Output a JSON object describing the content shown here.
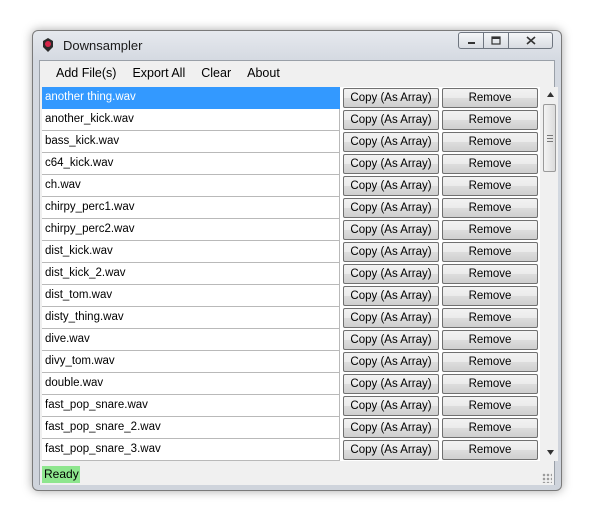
{
  "window": {
    "title": "Downsampler",
    "icons": {
      "app": "app-icon",
      "minimize": "minimize-icon",
      "maximize": "maximize-icon",
      "close": "close-icon"
    }
  },
  "menu": {
    "add_files": "Add File(s)",
    "export_all": "Export All",
    "clear": "Clear",
    "about": "About"
  },
  "list": {
    "selected_index": 0,
    "copy_label": "Copy (As Array)",
    "remove_label": "Remove",
    "files": [
      "another thing.wav",
      "another_kick.wav",
      "bass_kick.wav",
      "c64_kick.wav",
      "ch.wav",
      "chirpy_perc1.wav",
      "chirpy_perc2.wav",
      "dist_kick.wav",
      "dist_kick_2.wav",
      "dist_tom.wav",
      "disty_thing.wav",
      "dive.wav",
      "divy_tom.wav",
      "double.wav",
      "fast_pop_snare.wav",
      "fast_pop_snare_2.wav",
      "fast_pop_snare_3.wav"
    ]
  },
  "status": {
    "text": "Ready",
    "color": "#8ee68e"
  },
  "colors": {
    "selection": "#3399ff"
  }
}
